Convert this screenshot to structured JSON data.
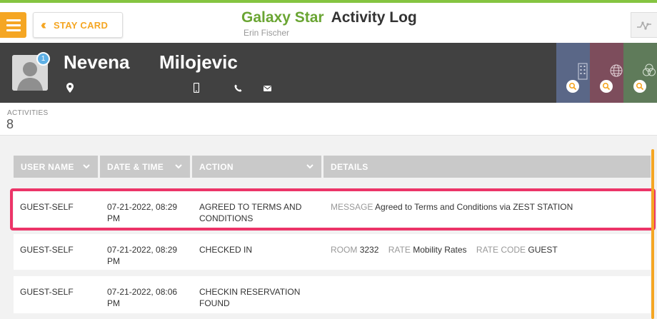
{
  "header": {
    "menu_icon": "hamburger-icon",
    "back_button": {
      "label": "STAY CARD",
      "icon": "double-chevron-left-icon"
    },
    "hotel_name": "Galaxy Star",
    "page_title": "Activity Log",
    "user_name": "Erin Fischer",
    "graph_icon": "activity-graph-icon"
  },
  "guest": {
    "first_name": "Nevena",
    "last_name": "Milojevic",
    "badge_count": "1",
    "icons": [
      "location-icon",
      "mobile-phone-icon",
      "phone-icon",
      "email-icon"
    ],
    "tabs": [
      {
        "name": "hotel-tab",
        "color": "#5a6787",
        "icon": "building-icon"
      },
      {
        "name": "globe-tab",
        "color": "#7d4d5c",
        "icon": "globe-icon"
      },
      {
        "name": "group-tab",
        "color": "#5f7b5a",
        "icon": "circles-icon"
      }
    ]
  },
  "summary": {
    "label": "ACTIVITIES",
    "count": "8"
  },
  "table": {
    "headers": [
      "USER NAME",
      "DATE & TIME",
      "ACTION",
      "DETAILS"
    ],
    "rows": [
      {
        "user": "GUEST-SELF",
        "date_line1": "07-21-2022, 08:29",
        "date_line2": "PM",
        "action_line1": "AGREED TO TERMS AND",
        "action_line2": "CONDITIONS",
        "details": [
          {
            "label": "MESSAGE",
            "value": "Agreed to Terms and Conditions via ZEST STATION"
          }
        ]
      },
      {
        "user": "GUEST-SELF",
        "date_line1": "07-21-2022, 08:29",
        "date_line2": "PM",
        "action_line1": "CHECKED IN",
        "action_line2": "",
        "details": [
          {
            "label": "ROOM",
            "value": "3232"
          },
          {
            "label": "RATE",
            "value": "Mobility Rates"
          },
          {
            "label": "RATE CODE",
            "value": "GUEST"
          }
        ]
      },
      {
        "user": "GUEST-SELF",
        "date_line1": "07-21-2022, 08:06",
        "date_line2": "PM",
        "action_line1": "CHECKIN RESERVATION",
        "action_line2": "FOUND",
        "details": []
      }
    ]
  },
  "colors": {
    "accent_orange": "#f5a623",
    "brand_green": "#6aa533",
    "highlight_pink": "#ec3468",
    "guest_bar": "#414141"
  }
}
